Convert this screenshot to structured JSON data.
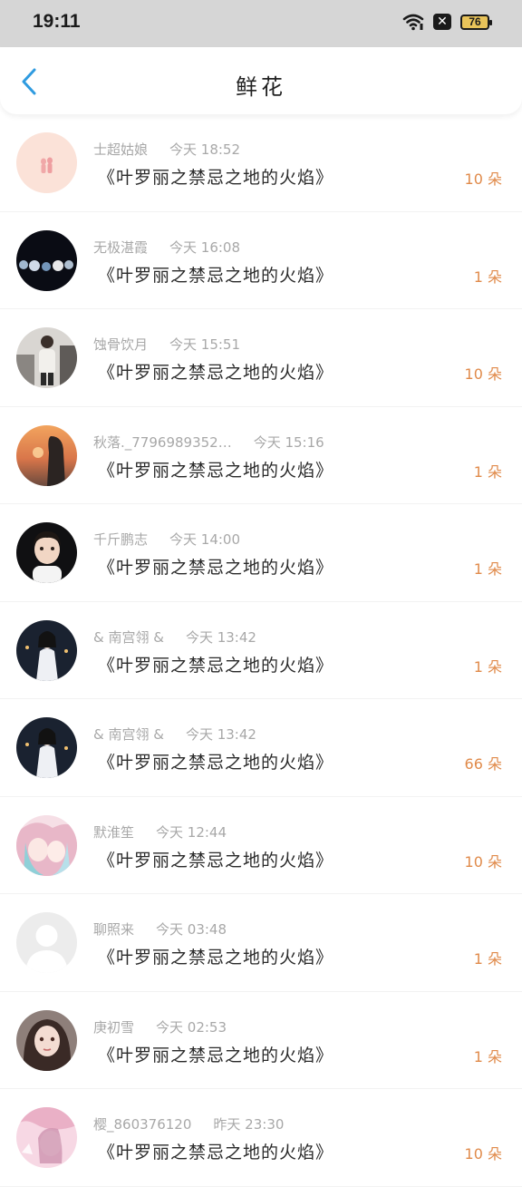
{
  "status_bar": {
    "time": "19:11",
    "battery": "76"
  },
  "nav": {
    "title": "鲜花"
  },
  "colors": {
    "accent": "#2f9be0",
    "count": "#e08a4a"
  },
  "items": [
    {
      "name": "士超姑娘",
      "time": "今天 18:52",
      "title": "《叶罗丽之禁忌之地的火焰》",
      "count": "10 朵",
      "avatar": "pink-figure-avatar"
    },
    {
      "name": "无极湛霞",
      "time": "今天 16:08",
      "title": "《叶罗丽之禁忌之地的火焰》",
      "count": "1 朵",
      "avatar": "bokeh-lights-avatar"
    },
    {
      "name": "蚀骨饮月",
      "time": "今天 15:51",
      "title": "《叶罗丽之禁忌之地的火焰》",
      "count": "10 朵",
      "avatar": "street-person-avatar"
    },
    {
      "name": "秋落._7796989352…",
      "time": "今天 15:16",
      "title": "《叶罗丽之禁忌之地的火焰》",
      "count": "1 朵",
      "avatar": "sunset-girl-avatar"
    },
    {
      "name": "千斤鹏志",
      "time": "今天 14:00",
      "title": "《叶罗丽之禁忌之地的火焰》",
      "count": "1 朵",
      "avatar": "child-portrait-avatar"
    },
    {
      "name": "& 南宫翎 &",
      "time": "今天 13:42",
      "title": "《叶罗丽之禁忌之地的火焰》",
      "count": "1 朵",
      "avatar": "dark-figure-avatar"
    },
    {
      "name": "& 南宫翎 &",
      "time": "今天 13:42",
      "title": "《叶罗丽之禁忌之地的火焰》",
      "count": "66 朵",
      "avatar": "dark-figure-avatar"
    },
    {
      "name": "默淮笙",
      "time": "今天 12:44",
      "title": "《叶罗丽之禁忌之地的火焰》",
      "count": "10 朵",
      "avatar": "anime-girls-avatar"
    },
    {
      "name": "聊照来",
      "time": "今天 03:48",
      "title": "《叶罗丽之禁忌之地的火焰》",
      "count": "1 朵",
      "avatar": "default-user-avatar"
    },
    {
      "name": "庚初雪",
      "time": "今天 02:53",
      "title": "《叶罗丽之禁忌之地的火焰》",
      "count": "1 朵",
      "avatar": "anime-portrait-avatar"
    },
    {
      "name": "樱_860376120",
      "time": "昨天 23:30",
      "title": "《叶罗丽之禁忌之地的火焰》",
      "count": "10 朵",
      "avatar": "pink-anime-avatar"
    }
  ]
}
